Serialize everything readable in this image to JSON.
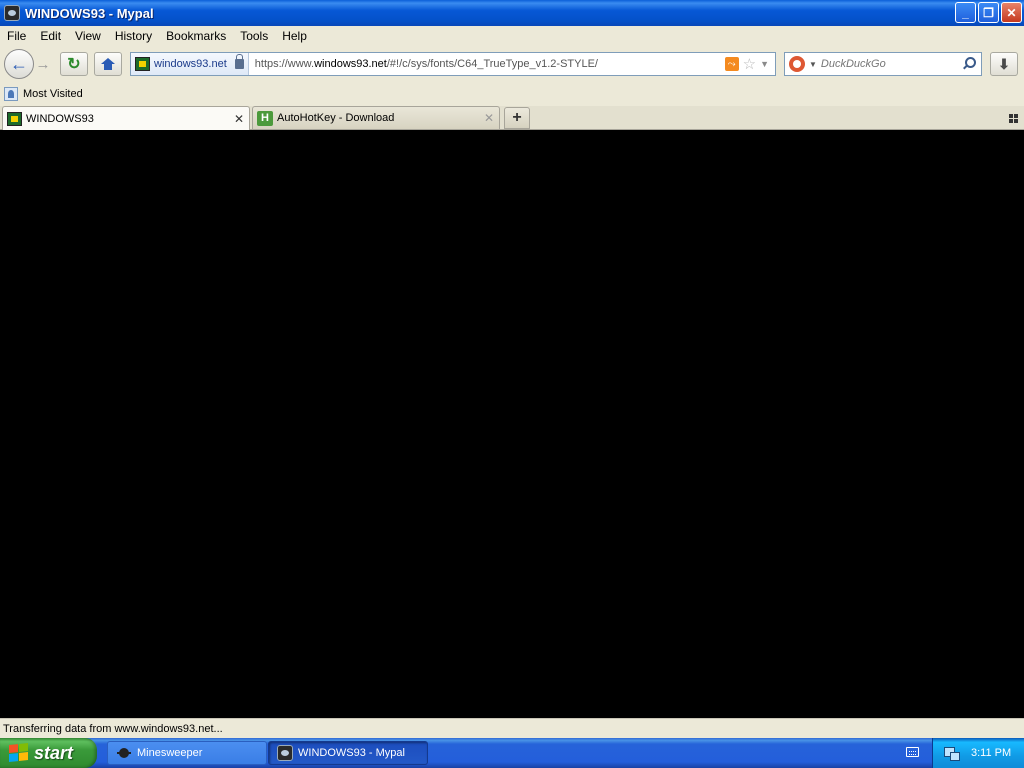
{
  "window": {
    "title": "WINDOWS93 - Mypal",
    "controls": {
      "minimize": "_",
      "maximize": "❐",
      "close": "✕"
    }
  },
  "menu": [
    "File",
    "Edit",
    "View",
    "History",
    "Bookmarks",
    "Tools",
    "Help"
  ],
  "nav": {
    "identity_label": "windows93.net",
    "url_prefix": "https://www.",
    "url_host": "windows93.net",
    "url_path": "/#!/c/sys/fonts/C64_TrueType_v1.2-STYLE/",
    "search_placeholder": "DuckDuckGo"
  },
  "bookmarks": [
    "Most Visited"
  ],
  "tabs": [
    {
      "label": "WINDOWS93",
      "active": true,
      "icon": "windows93-site-icon"
    },
    {
      "label": "AutoHotKey - Download",
      "active": false,
      "icon": "autohotkey-icon"
    }
  ],
  "status": {
    "text": "Transferring data from www.windows93.net..."
  },
  "taskbar": {
    "start_label": "start",
    "tasks": [
      {
        "label": "Minesweeper",
        "active": false
      },
      {
        "label": "WINDOWS93 - Mypal",
        "active": true
      }
    ],
    "clock": "3:11 PM"
  },
  "colors": {
    "content_background": "#000000",
    "chrome": "#ece9d8",
    "titlebar": "#0758d6",
    "taskbar": "#245edb",
    "start": "#3a9a3a"
  }
}
